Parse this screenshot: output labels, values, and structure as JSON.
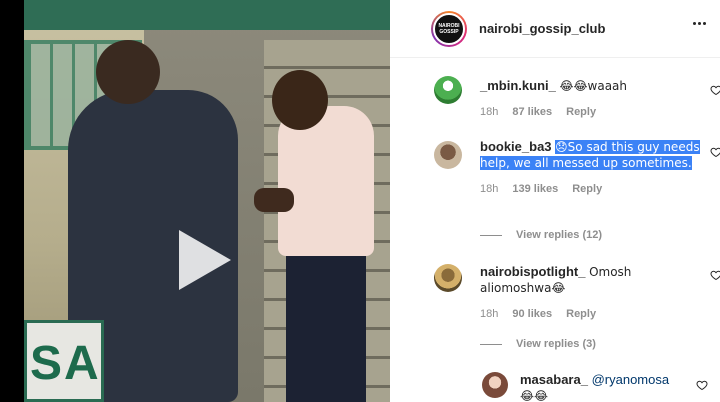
{
  "post": {
    "username": "nairobi_gossip_club",
    "avatar_text": "NAIROBI\nGOSSIP\nCLUB"
  },
  "video": {
    "sign_text": "SA"
  },
  "comments": [
    {
      "username": "_mbin.kuni_",
      "text": "😂😂waaah",
      "time": "18h",
      "likes": "87 likes",
      "reply_label": "Reply"
    },
    {
      "username": "bookie_ba3",
      "text_highlighted": "😞So sad this guy needs help, we all messed up sometimes.",
      "time": "18h",
      "likes": "139 likes",
      "reply_label": "Reply",
      "view_replies": "View replies (12)"
    },
    {
      "username": "nairobispotlight_",
      "text": "Omosh aliomoshwa😂",
      "time": "18h",
      "likes": "90 likes",
      "reply_label": "Reply",
      "view_replies": "View replies (3)"
    },
    {
      "username": "masabara_",
      "mention": "@ryanomosa",
      "text": "😂😂"
    }
  ],
  "colors": {
    "highlight": "#3b82f6",
    "meta_gray": "#8e8e8e",
    "mention_blue": "#00376b"
  }
}
